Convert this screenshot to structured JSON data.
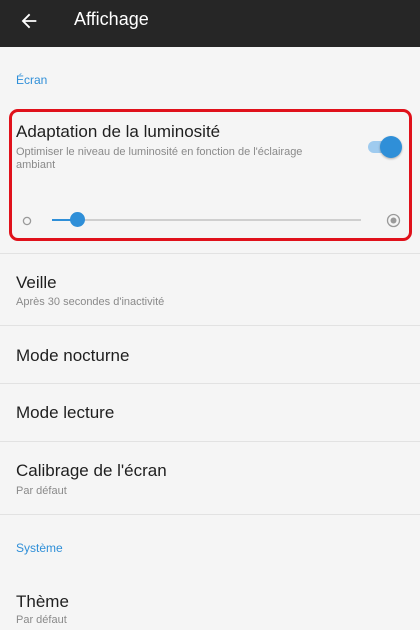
{
  "appbar": {
    "title": "Affichage",
    "back_icon": "arrow-left-icon"
  },
  "colors": {
    "appbar_bg": "#262626",
    "accent": "#2f8fd8",
    "highlight_border": "#e0111b",
    "background": "#f5f5f5"
  },
  "sections": {
    "ecran": "Écran",
    "systeme": "Système"
  },
  "brightness": {
    "title": "Adaptation de la luminosité",
    "subtitle": "Optimiser le niveau de luminosité en fonction de l'éclairage ambiant",
    "toggle_on": true,
    "level": 0.08,
    "min_icon": "circle-outline-icon",
    "max_icon": "radio-circle-icon"
  },
  "prefs": {
    "veille": {
      "title": "Veille",
      "subtitle": "Après 30 secondes d'inactivité"
    },
    "mode_nocturne": {
      "title": "Mode nocturne"
    },
    "mode_lecture": {
      "title": "Mode lecture"
    },
    "calibrage": {
      "title": "Calibrage de l'écran",
      "subtitle": "Par défaut"
    },
    "theme": {
      "title": "Thème",
      "subtitle": "Par défaut"
    }
  }
}
